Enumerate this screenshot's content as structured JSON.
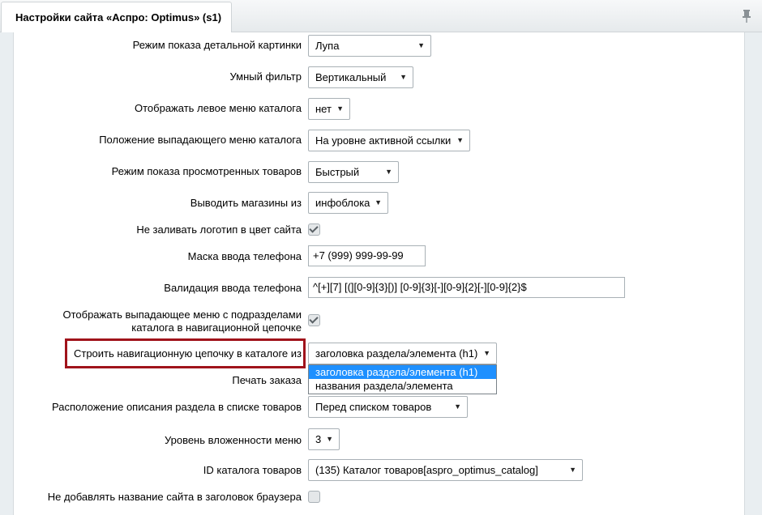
{
  "window": {
    "title": "Настройки сайта «Аспро: Optimus» (s1)",
    "pin_icon": "pin-icon"
  },
  "rows": {
    "detail_picture": {
      "label": "Режим показа детальной картинки",
      "value": "Лупа"
    },
    "smart_filter": {
      "label": "Умный фильтр",
      "value": "Вертикальный"
    },
    "left_menu": {
      "label": "Отображать левое меню каталога",
      "value": "нет"
    },
    "dropdown_menu_position": {
      "label": "Положение выпадающего меню каталога",
      "value": "На уровне активной ссылки"
    },
    "viewed_products_mode": {
      "label": "Режим показа просмотренных товаров",
      "value": "Быстрый"
    },
    "stores_source": {
      "label": "Выводить магазины из",
      "value": "инфоблока"
    },
    "logo_no_fill": {
      "label": "Не заливать логотип в цвет сайта",
      "checked": true
    },
    "phone_mask": {
      "label": "Маска ввода телефона",
      "value": "+7 (999) 999-99-99"
    },
    "phone_validation": {
      "label": "Валидация ввода телефона",
      "value": "^[+][7] [(][0-9]{3}[)] [0-9]{3}[-][0-9]{2}[-][0-9]{2}$"
    },
    "breadcrumb_submenu": {
      "label_line1": "Отображать выпадающее меню с подразделами",
      "label_line2": "каталога в навигационной цепочке",
      "checked": true
    },
    "breadcrumb_source": {
      "label": "Строить навигационную цепочку в каталоге из",
      "value": "заголовка раздела/элемента (h1)",
      "options": [
        "заголовка раздела/элемента (h1)",
        "названия раздела/элемента"
      ]
    },
    "print_order": {
      "label": "Печать заказа"
    },
    "section_description_position": {
      "label": "Расположение описания раздела в списке товаров",
      "value": "Перед списком товаров"
    },
    "menu_depth": {
      "label": "Уровень вложенности меню",
      "value": "3"
    },
    "catalog_id": {
      "label": "ID каталога товаров",
      "value": "(135) Каталог товаров[aspro_optimus_catalog]"
    },
    "no_site_name_title": {
      "label": "Не добавлять название сайта в заголовок браузера",
      "checked": false
    }
  },
  "colors": {
    "highlight": "#a0131b",
    "selected_option": "#1e90ff"
  }
}
